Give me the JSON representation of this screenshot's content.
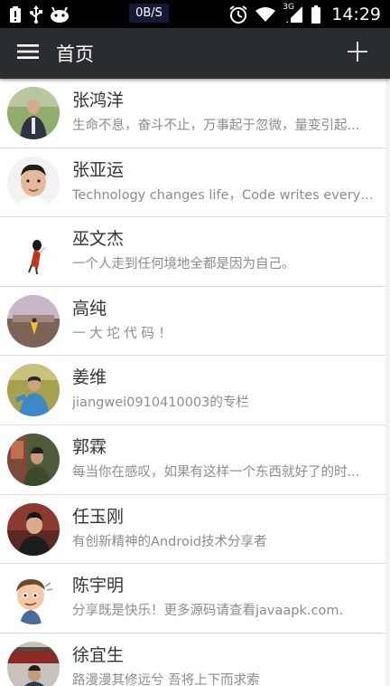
{
  "status_bar": {
    "net_speed": "0B/S",
    "signal_type": "3G",
    "time": "14:29",
    "icons": [
      "battery-alert-icon",
      "usb-icon",
      "android-icon",
      "alarm-icon",
      "wifi-icon",
      "cell-signal-icon",
      "battery-icon"
    ]
  },
  "app_bar": {
    "title": "首页",
    "menu_icon": "hamburger-menu-icon",
    "add_icon": "plus-icon"
  },
  "contacts": [
    {
      "name": "张鸿洋",
      "desc": "生命不息，奋斗不止，万事起于忽微，量变引起..."
    },
    {
      "name": "张亚运",
      "desc": "Technology changes life，Code writes everythi..."
    },
    {
      "name": "巫文杰",
      "desc": "一个人走到任何境地全都是因为自己。"
    },
    {
      "name": "高纯",
      "desc": "一 大 坨 代 码 ！"
    },
    {
      "name": "姜维",
      "desc": "jiangwei0910410003的专栏"
    },
    {
      "name": "郭霖",
      "desc": "每当你在感叹，如果有这样一个东西就好了的时..."
    },
    {
      "name": "任玉刚",
      "desc": "有创新精神的Android技术分享者"
    },
    {
      "name": "陈宇明",
      "desc": "分享既是快乐！更多源码请查看javaapk.com."
    },
    {
      "name": "徐宜生",
      "desc": "路漫漫其修远兮 吾将上下而求索"
    }
  ],
  "colors": {
    "status_bar_bg": "#000000",
    "app_bar_bg": "#2a2d2f",
    "name_text": "#333333",
    "desc_text": "#8c8c8c",
    "divider": "#dddddd"
  }
}
